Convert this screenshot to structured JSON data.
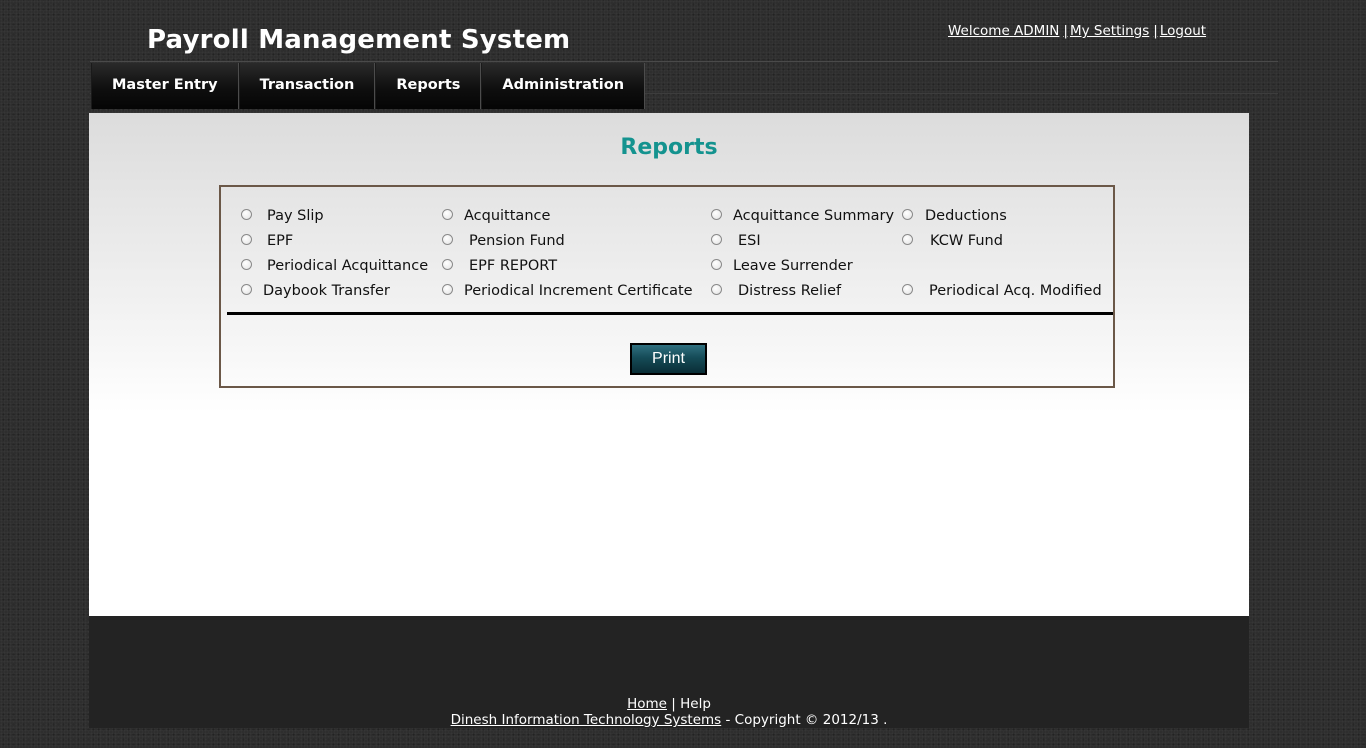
{
  "header": {
    "title": "Payroll Management System",
    "welcome_link": "Welcome ADMIN",
    "separator": "|",
    "settings_link": "My Settings",
    "logout_link": "Logout"
  },
  "nav": {
    "items": [
      {
        "label": "Master Entry"
      },
      {
        "label": "Transaction"
      },
      {
        "label": "Reports"
      },
      {
        "label": "Administration"
      }
    ]
  },
  "main": {
    "heading": "Reports",
    "options": [
      "Pay Slip",
      "Acquittance",
      "Acquittance Summary",
      "Deductions",
      "EPF",
      "Pension Fund",
      "ESI",
      "KCW Fund",
      "Periodical Acquittance",
      "EPF REPORT",
      "Leave Surrender",
      "Daybook Transfer",
      "Periodical Increment Certificate",
      "Distress Relief",
      "Periodical Acq. Modified"
    ],
    "print_label": "Print"
  },
  "footer": {
    "home_link": "Home",
    "separator": "|",
    "help_text": "Help",
    "company_link": "Dinesh Information Technology Systems",
    "copyright": "- Copyright © 2012/13 ."
  },
  "colors": {
    "heading": "#14938f",
    "button": "#154b57",
    "box_border": "#6b5848"
  }
}
